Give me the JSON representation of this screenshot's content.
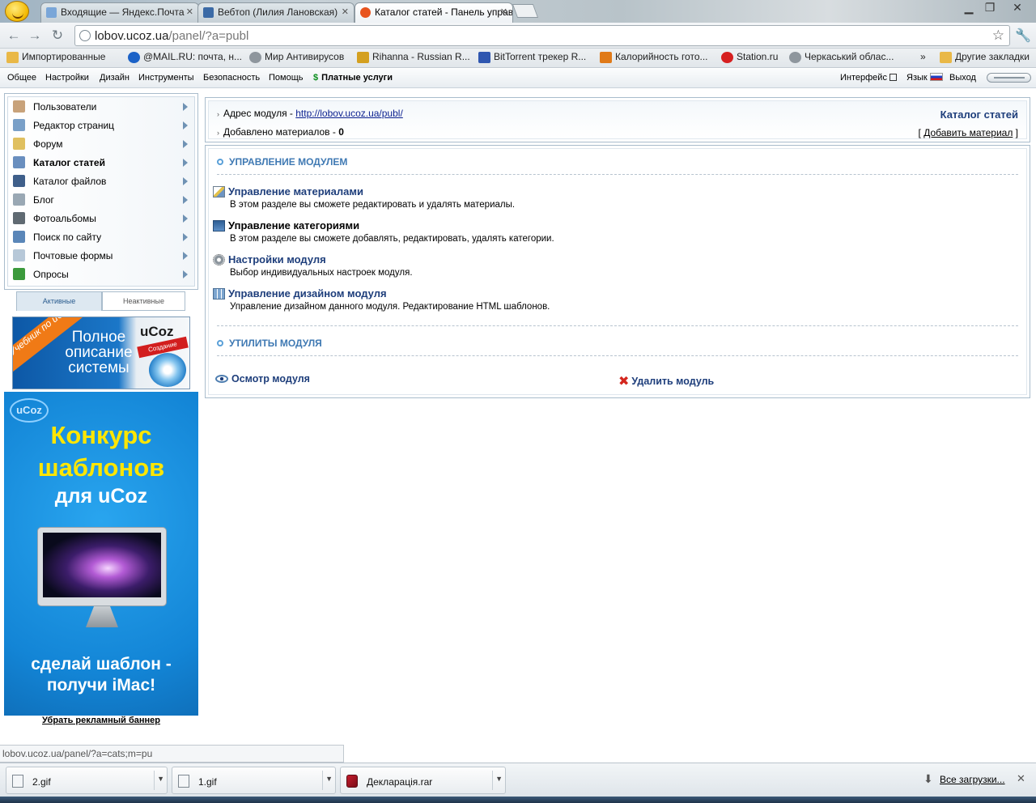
{
  "browser": {
    "tabs": [
      {
        "title": "Входящие — Яндекс.Почта",
        "favicon_color": "#7aa6d8"
      },
      {
        "title": "Вебтоп (Лилия Лановская)",
        "favicon_color": "#3b6aa6"
      },
      {
        "title": "Каталог статей - Панель управления",
        "favicon_color": "#e8541e",
        "active": true
      }
    ],
    "url": {
      "host": "lobov.ucoz.ua",
      "path": "/panel/?a=publ"
    },
    "bookmarks": [
      {
        "label": "Импортированные",
        "icon": "folder-icon",
        "color": "#e9b847"
      },
      {
        "label": "@MAIL.RU: почта, н...",
        "icon": "mailru-icon",
        "color": "#1b62c7"
      },
      {
        "label": "Мир Антивирусов",
        "icon": "globe-icon",
        "color": "#8e969d"
      },
      {
        "label": "Rihanna - Russian R...",
        "icon": "pencil-icon",
        "color": "#d4a020"
      },
      {
        "label": "BitTorrent трекер R...",
        "icon": "bittorrent-icon",
        "color": "#2f57b0"
      },
      {
        "label": "Калорийность гото...",
        "icon": "home-icon",
        "color": "#e07a18"
      },
      {
        "label": "Station.ru",
        "icon": "station-icon",
        "color": "#d62020"
      },
      {
        "label": "Черкаський облас...",
        "icon": "globe-icon",
        "color": "#8e969d"
      },
      {
        "label": "Другие закладки",
        "icon": "folder-icon",
        "color": "#e9b847"
      }
    ]
  },
  "menu": {
    "items": [
      "Общее",
      "Настройки",
      "Дизайн",
      "Инструменты",
      "Безопасность",
      "Помощь"
    ],
    "paid": "Платные услуги",
    "interface": "Интерфейс",
    "language": "Язык",
    "logout": "Выход"
  },
  "sidebar": {
    "items": [
      {
        "label": "Пользователи",
        "icon": "users-icon",
        "color": "#c8a27a"
      },
      {
        "label": "Редактор страниц",
        "icon": "page-editor-icon",
        "color": "#7aa0c8"
      },
      {
        "label": "Форум",
        "icon": "forum-icon",
        "color": "#e0c060"
      },
      {
        "label": "Каталог статей",
        "icon": "articles-icon",
        "color": "#6a8fbf",
        "current": true
      },
      {
        "label": "Каталог файлов",
        "icon": "files-icon",
        "color": "#3f5f8a"
      },
      {
        "label": "Блог",
        "icon": "blog-icon",
        "color": "#9aa8b4"
      },
      {
        "label": "Фотоальбомы",
        "icon": "camera-icon",
        "color": "#606a72"
      },
      {
        "label": "Поиск по сайту",
        "icon": "search-icon",
        "color": "#5a86b8"
      },
      {
        "label": "Почтовые формы",
        "icon": "mail-forms-icon",
        "color": "#b7c8d8"
      },
      {
        "label": "Опросы",
        "icon": "polls-icon",
        "color": "#3c9a3c"
      }
    ],
    "tab_active": "Активные",
    "tab_inactive": "Неактивные"
  },
  "banner1": {
    "ribbon": "Учебник по uCoz",
    "text_lines": [
      "Полное",
      "описание",
      "системы"
    ],
    "brand": "uCoz",
    "tagline": "Создание сайтов"
  },
  "banner2": {
    "logo": "uCoz",
    "title1": "Конкурс",
    "title2": "шаблонов",
    "title3": "для uCoz",
    "cta1": "сделай шаблон -",
    "cta2": "получи iMac!"
  },
  "remove_banner": "Убрать рекламный баннер",
  "info": {
    "address_label": "Адрес модуля - ",
    "address_link": "http://lobov.ucoz.ua/publ/",
    "added_label": "Добавлено материалов - ",
    "added_count": "0",
    "module_title": "Каталог статей",
    "add_material": "Добавить материал"
  },
  "manage": {
    "section_title": "УПРАВЛЕНИЕ МОДУЛЕМ",
    "items": [
      {
        "title": "Управление материалами",
        "desc": "В этом разделе вы сможете редактировать и удалять материалы."
      },
      {
        "title": "Управление категориями",
        "desc": "В этом разделе вы сможете добавлять, редактировать, удалять категории."
      },
      {
        "title": "Настройки модуля",
        "desc": "Выбор индивидуальных настроек модуля."
      },
      {
        "title": "Управление дизайном модуля",
        "desc": "Управление дизайном данного модуля. Редактирование HTML шаблонов."
      }
    ],
    "utils_title": "УТИЛИТЫ МОДУЛЯ",
    "view_module": "Осмотр модуля",
    "delete_module": "Удалить модуль"
  },
  "status_url": "lobov.ucoz.ua/panel/?a=cats;m=pu",
  "downloads": {
    "files": [
      {
        "name": "2.gif",
        "type": "gif"
      },
      {
        "name": "1.gif",
        "type": "gif"
      },
      {
        "name": "Декларація.rar",
        "type": "rar"
      }
    ],
    "all_label": "Все загрузки..."
  }
}
